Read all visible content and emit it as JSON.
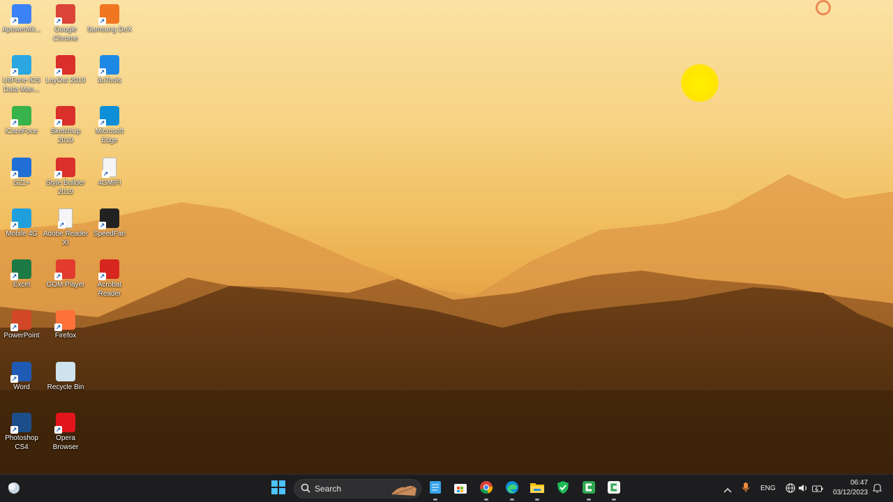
{
  "desktop": {
    "icons": [
      {
        "label": "ApowerMir...",
        "icon": "apowermirror-icon",
        "color": "#3b82f6"
      },
      {
        "label": "Google Chrome",
        "icon": "chrome-icon",
        "color": "#db4437"
      },
      {
        "label": "Samsung DeX",
        "icon": "samsung-dex-icon",
        "color": "#f07622"
      },
      {
        "label": "UltFone iOS Data Man...",
        "icon": "ultfone-icon",
        "color": "#2aa7e0"
      },
      {
        "label": "LayOut 2019",
        "icon": "layout-icon",
        "color": "#d9302b"
      },
      {
        "label": "3uTools",
        "icon": "3utools-icon",
        "color": "#1e88e5"
      },
      {
        "label": "iCareFone",
        "icon": "icarefone-icon",
        "color": "#38b24a"
      },
      {
        "label": "SketchUp 2019",
        "icon": "sketchup-icon",
        "color": "#d9302b"
      },
      {
        "label": "Microsoft Edge",
        "icon": "edge-icon",
        "color": "#0c8fd6"
      },
      {
        "label": "S21+",
        "icon": "s21-icon",
        "color": "#1f6fd6"
      },
      {
        "label": "Style Builder 2019",
        "icon": "style-builder-icon",
        "color": "#d9302b"
      },
      {
        "label": "4GMIFI",
        "icon": "file-icon",
        "color": "#f5f5f5"
      },
      {
        "label": "Mobile 4G",
        "icon": "mobile-4g-icon",
        "color": "#1fa0dd"
      },
      {
        "label": "Adobe Reader XI",
        "icon": "file-icon",
        "color": "#f5f5f5"
      },
      {
        "label": "SpeedFan",
        "icon": "speedfan-icon",
        "color": "#222222"
      },
      {
        "label": "Excel",
        "icon": "excel-icon",
        "color": "#1d7a45"
      },
      {
        "label": "GOM Player",
        "icon": "gom-player-icon",
        "color": "#e23b2e"
      },
      {
        "label": "Acrobat Reader",
        "icon": "acrobat-icon",
        "color": "#d7261e"
      },
      {
        "label": "PowerPoint",
        "icon": "powerpoint-icon",
        "color": "#d24726"
      },
      {
        "label": "Firefox",
        "icon": "firefox-icon",
        "color": "#ff7139"
      },
      {
        "label": "Word",
        "icon": "word-icon",
        "color": "#1f5bb5"
      },
      {
        "label": "Recycle Bin",
        "icon": "recycle-bin-icon",
        "color": "#cfe3ee"
      },
      {
        "label": "Photoshop CS4",
        "icon": "photoshop-icon",
        "color": "#1c4e8a"
      },
      {
        "label": "Opera Browser",
        "icon": "opera-icon",
        "color": "#e1151b"
      }
    ]
  },
  "taskbar": {
    "search_label": "Search",
    "pinned": [
      {
        "name": "start",
        "icon": "windows-start-icon"
      },
      {
        "name": "notepad",
        "icon": "notepad-icon"
      },
      {
        "name": "store",
        "icon": "microsoft-store-icon"
      },
      {
        "name": "chrome",
        "icon": "chrome-icon"
      },
      {
        "name": "edge",
        "icon": "edge-icon"
      },
      {
        "name": "explorer",
        "icon": "file-explorer-icon"
      },
      {
        "name": "kaspersky",
        "icon": "shield-app-icon"
      },
      {
        "name": "camtasia",
        "icon": "camtasia-icon"
      },
      {
        "name": "camtasia-recorder",
        "icon": "camtasia-recorder-icon"
      }
    ],
    "tray": {
      "lang": "ENG",
      "time": "06:47",
      "date": "03/12/2023"
    }
  }
}
